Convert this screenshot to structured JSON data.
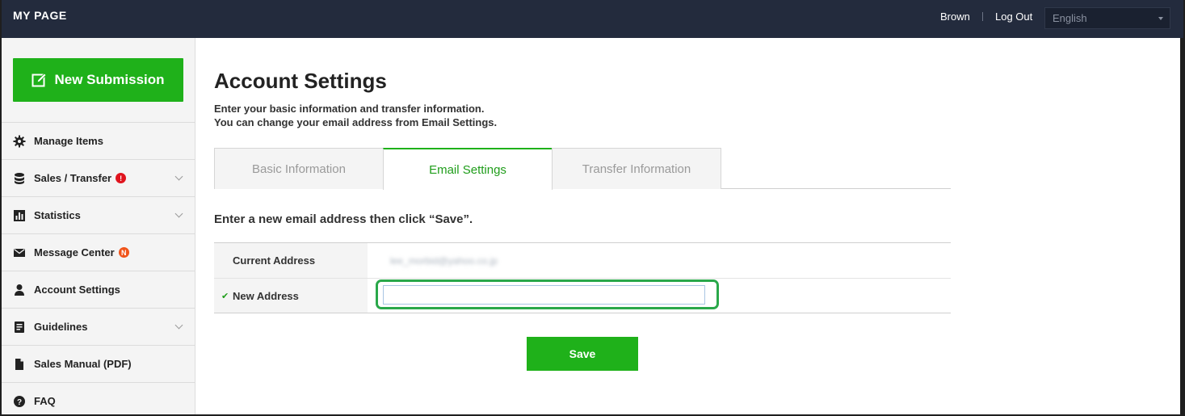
{
  "header": {
    "brand": "MY PAGE",
    "user_name": "Brown",
    "logout_label": "Log Out",
    "language": "English"
  },
  "sidebar": {
    "new_submission_label": "New Submission",
    "items": [
      {
        "label": "Manage Items",
        "icon": "gear-icon"
      },
      {
        "label": "Sales / Transfer",
        "icon": "database-icon",
        "badge": "!"
      },
      {
        "label": "Statistics",
        "icon": "bar-chart-icon"
      },
      {
        "label": "Message Center",
        "icon": "envelope-icon",
        "badge": "N"
      },
      {
        "label": "Account Settings",
        "icon": "person-icon"
      },
      {
        "label": "Guidelines",
        "icon": "document-icon"
      },
      {
        "label": "Sales Manual (PDF)",
        "icon": "file-icon"
      },
      {
        "label": "FAQ",
        "icon": "question-icon"
      }
    ]
  },
  "main": {
    "title": "Account Settings",
    "description_line1": "Enter your basic information and transfer information.",
    "description_line2": "You can change your email address from Email Settings.",
    "tabs": [
      {
        "label": "Basic Information",
        "active": false
      },
      {
        "label": "Email Settings",
        "active": true
      },
      {
        "label": "Transfer Information",
        "active": false
      }
    ],
    "instruction": "Enter a new email address then click “Save”.",
    "current_address_label": "Current Address",
    "current_address_value": "lee_morbid@yahoo.co.jp",
    "new_address_label": "New Address",
    "new_address_value": "",
    "save_label": "Save"
  },
  "colors": {
    "header_bg": "#232b3d",
    "accent_green": "#1fb11a",
    "highlight_green": "#2aa84a",
    "badge_red": "#e0141e",
    "badge_orange": "#f0541a"
  }
}
